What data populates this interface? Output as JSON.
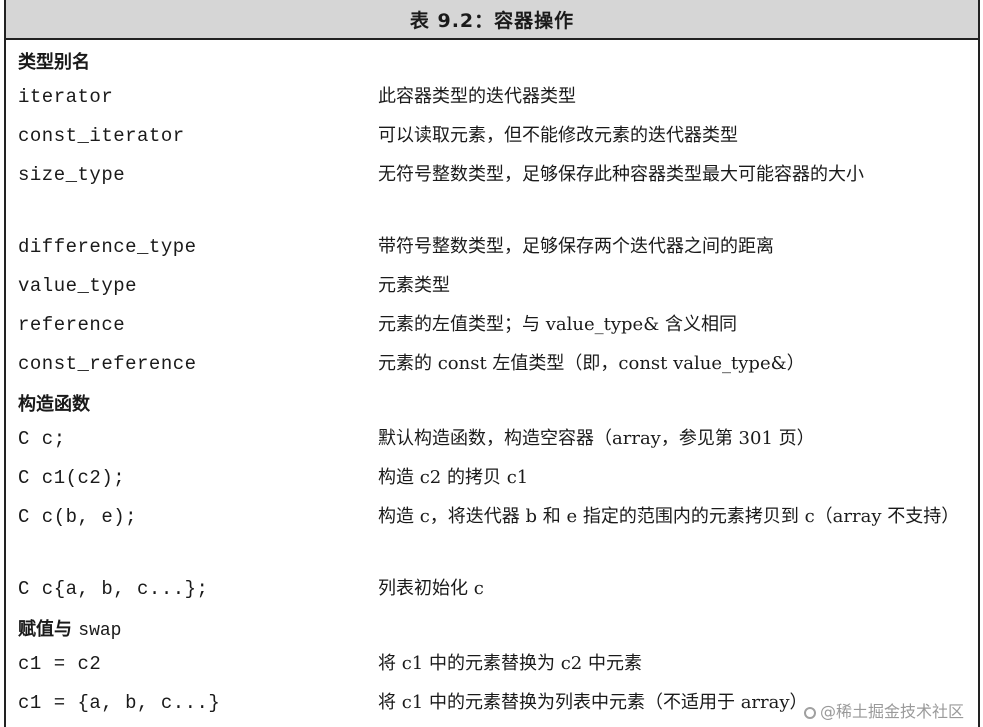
{
  "title": "表 9.2：容器操作",
  "sections": [
    {
      "label": "类型别名",
      "label_code": "",
      "rows": [
        {
          "left": "iterator",
          "right": "此容器类型的迭代器类型"
        },
        {
          "left": "const_iterator",
          "right": "可以读取元素，但不能修改元素的迭代器类型"
        },
        {
          "left": "size_type",
          "right": "无符号整数类型，足够保存此种容器类型最大可能容器的大小"
        },
        {
          "left": "difference_type",
          "right": "带符号整数类型，足够保存两个迭代器之间的距离"
        },
        {
          "left": "value_type",
          "right": "元素类型"
        },
        {
          "left": "reference",
          "right": "元素的左值类型；与 value_type& 含义相同"
        },
        {
          "left": "const_reference",
          "right": "元素的 const 左值类型（即，const value_type&）"
        }
      ]
    },
    {
      "label": "构造函数",
      "label_code": "",
      "rows": [
        {
          "left": "C c;",
          "right": "默认构造函数，构造空容器（array，参见第 301 页）"
        },
        {
          "left": "C c1(c2);",
          "right": "构造 c2 的拷贝 c1"
        },
        {
          "left": "C c(b, e);",
          "right": "构造 c，将迭代器 b 和 e 指定的范围内的元素拷贝到 c（array 不支持）"
        },
        {
          "left": "C c{a, b, c...};",
          "right": "列表初始化 c"
        }
      ]
    },
    {
      "label": "赋值与 ",
      "label_code": "swap",
      "rows": [
        {
          "left": "c1 = c2",
          "right": "将 c1 中的元素替换为 c2 中元素"
        },
        {
          "left": "c1 = {a, b, c...}",
          "right": "将 c1 中的元素替换为列表中元素（不适用于 array）"
        }
      ]
    }
  ],
  "watermark": "@稀土掘金技术社区"
}
